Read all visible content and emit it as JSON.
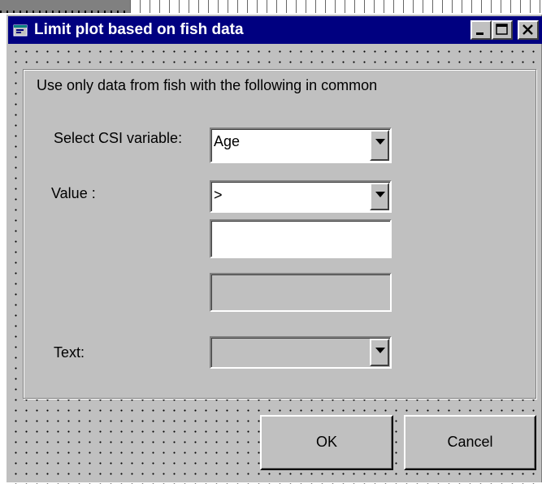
{
  "window": {
    "title": "Limit plot based on fish data",
    "titlebar_color": "#000080",
    "icons": [
      "app-icon",
      "minimize-icon",
      "maximize-icon",
      "close-icon"
    ]
  },
  "frame": {
    "caption": "Use only data from fish with the following in common"
  },
  "form": {
    "csi_label": "Select CSI variable:",
    "csi_value": "Age",
    "value_label": "Value :",
    "operator_value": ">",
    "value_input": "",
    "value_secondary": "",
    "text_label": "Text:",
    "text_value": ""
  },
  "buttons": {
    "ok": "OK",
    "cancel": "Cancel"
  }
}
